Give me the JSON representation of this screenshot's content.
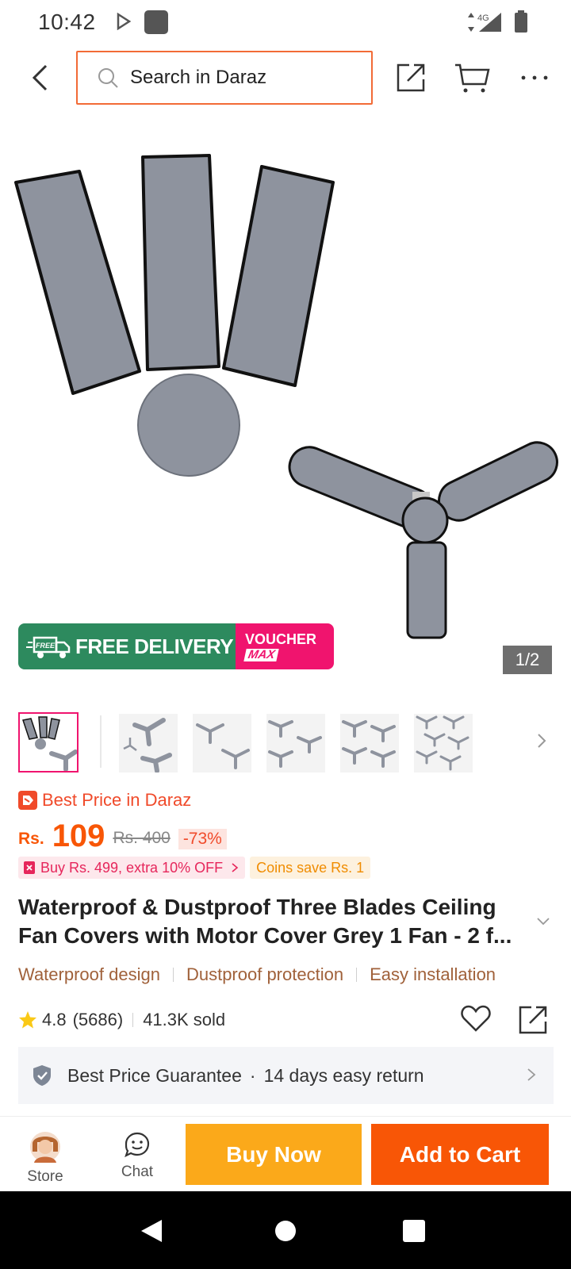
{
  "status_bar": {
    "time": "10:42",
    "network": "4G",
    "icons": [
      "play-store-icon",
      "app-notification-icon",
      "signal-icon",
      "battery-icon"
    ]
  },
  "header": {
    "search_placeholder": "Search in Daraz",
    "icons": [
      "back-arrow-icon",
      "search-icon",
      "share-icon",
      "cart-icon",
      "more-icon"
    ]
  },
  "gallery": {
    "image": "grey ceiling fan blade covers and motor cover",
    "badge_free_delivery": "FREE DELIVERY",
    "badge_free_small": "FREE",
    "badge_voucher": "VOUCHER",
    "badge_max": "MAX",
    "page_indicator": "1/2",
    "thumbnail_count": 6
  },
  "product": {
    "best_price_label": "Best Price in Daraz",
    "currency": "Rs.",
    "price": "109",
    "original_price": "Rs. 400",
    "discount": "-73%",
    "promo_buy": "Buy Rs. 499, extra 10% OFF",
    "promo_coins": "Coins save Rs. 1",
    "title_line1": "Waterproof & Dustproof Three Blades Ceiling",
    "title_line2": "Fan Covers with Motor Cover Grey 1 Fan - 2 f...",
    "features": [
      "Waterproof design",
      "Dustproof protection",
      "Easy installation"
    ],
    "rating": "4.8",
    "rating_count": "(5686)",
    "sold": "41.3K sold",
    "guarantee": "Best Price Guarantee",
    "guarantee_sep": "·",
    "return_policy": "14 days easy return"
  },
  "bottom_bar": {
    "store_label": "Store",
    "chat_label": "Chat",
    "buy_now": "Buy Now",
    "add_to_cart": "Add to Cart"
  },
  "colors": {
    "brand_orange": "#f85606",
    "buy_now_yellow": "#fba91a",
    "delivery_green": "#2d8a5e",
    "voucher_pink": "#f0146e",
    "feature_brown": "#a0613a"
  }
}
